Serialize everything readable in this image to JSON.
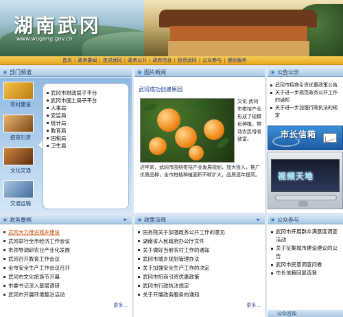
{
  "site": {
    "title": "湖南武冈",
    "url": "www.wugang.gov.cn"
  },
  "nav": [
    "首页",
    "政务要闻",
    "走进武冈",
    "政务公开",
    "政府信息",
    "投资武冈",
    "公众参与",
    "便民服务"
  ],
  "dept": {
    "header": "部门频道",
    "icons": [
      {
        "label": "农村建设"
      },
      {
        "label": "招商引资"
      },
      {
        "label": "文化交通"
      },
      {
        "label": "交通运输"
      }
    ],
    "items": [
      "武冈市财政局子平台",
      "武冈市国土局子平台",
      "人事局",
      "安监局",
      "统计局",
      "教育局",
      "国税局",
      "卫生局"
    ]
  },
  "news": {
    "header": "图片新闻",
    "headline": "武冈成功创建果园",
    "side_text": "又讯 武冈市柑桔产业形成了规模化种植，带动农民增收致富。",
    "body_text": "近年来，武冈市围绕柑桔产业发展规划，加大投入，推广优质品种，全市柑桔种植面积不断扩大，品质逐年提高。"
  },
  "notice": {
    "header": "公告公示",
    "items": [
      "武冈市招商引资优惠政策公告",
      "关于进一步规范政务公开工作的通知",
      "关于进一步加强行政执法的规定"
    ]
  },
  "mayor": {
    "label": "市长信箱"
  },
  "video": {
    "label": "视频天地"
  },
  "bottom": {
    "left": {
      "header": "政务要闻",
      "items": [
        "武冈大力推进城乡建设",
        "武冈举行全市经济工作会议",
        "市领导调研农业产业化发展",
        "武冈召开教育工作会议",
        "全市安全生产工作会议召开",
        "武冈市文化旅游节开幕",
        "市委书记深入基层调研",
        "武冈市开展环境整治活动"
      ],
      "more": "更多..."
    },
    "mid": {
      "header": "政策法规",
      "items": [
        "国务院关于加强政务公开工作的意见",
        "湖南省人民政府办公厅文件",
        "关于做好当前农村工作的通知",
        "武冈市城乡规划管理办法",
        "关于加强安全生产工作的决定",
        "武冈市招商引资优惠政策",
        "武冈市行政执法规定",
        "关于开展政务服务的通知"
      ],
      "more": "更多..."
    },
    "right": {
      "header": "公众参与",
      "items": [
        "武冈市开展群众满意度调查活动",
        "关于征集城市建设建议的公告",
        "武冈市民意调查问卷",
        "市长信箱回复选登"
      ]
    },
    "tiny": "公众咨询"
  }
}
